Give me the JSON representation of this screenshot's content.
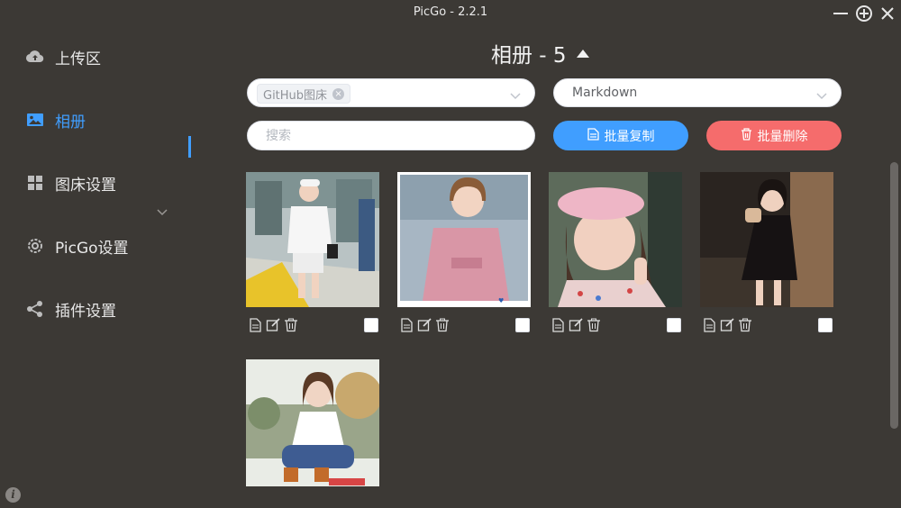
{
  "window": {
    "title": "PicGo - 2.2.1"
  },
  "sidebar": {
    "items": [
      {
        "label": "上传区",
        "icon": "cloud-upload-icon"
      },
      {
        "label": "相册",
        "icon": "image-icon",
        "active": true
      },
      {
        "label": "图床设置",
        "icon": "grid-icon",
        "expandable": true
      },
      {
        "label": "PicGo设置",
        "icon": "gear-icon"
      },
      {
        "label": "插件设置",
        "icon": "share-icon"
      }
    ]
  },
  "gallery": {
    "title": "相册 - 5",
    "filter_tag": "GitHub图床",
    "format_value": "Markdown",
    "search_placeholder": "搜索",
    "copy_button": "批量复制",
    "delete_button": "批量删除",
    "photos": [
      {
        "subject": "girl in white outfit at airport"
      },
      {
        "subject": "girl in pink dress"
      },
      {
        "subject": "girl with pink headband making peace sign"
      },
      {
        "subject": "girl in black dress holding cup"
      },
      {
        "subject": "girl sitting outdoors in denim"
      }
    ]
  },
  "colors": {
    "accent": "#409eff",
    "danger": "#f56c6c",
    "background": "#3c3935"
  }
}
